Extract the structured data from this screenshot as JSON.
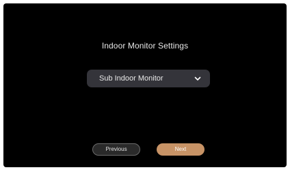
{
  "title": "Indoor Monitor Settings",
  "select": {
    "value": "Sub Indoor Monitor",
    "icon": "chevron-down-icon"
  },
  "buttons": {
    "previous": "Previous",
    "next": "Next"
  },
  "colors": {
    "background": "#000000",
    "select_bg": "#34343a",
    "accent": "#c79366"
  }
}
